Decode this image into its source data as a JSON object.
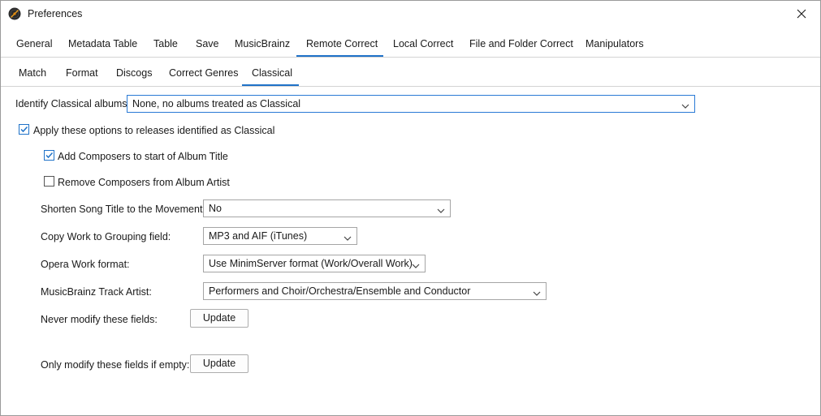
{
  "window": {
    "title": "Preferences",
    "app_icon": "record-disc-icon",
    "close_icon": "close-icon"
  },
  "main_tabs": [
    {
      "label": "General"
    },
    {
      "label": "Metadata Table"
    },
    {
      "label": "Table"
    },
    {
      "label": "Save"
    },
    {
      "label": "MusicBrainz"
    },
    {
      "label": "Remote Correct",
      "active": true
    },
    {
      "label": "Local Correct"
    },
    {
      "label": "File and Folder Correct"
    },
    {
      "label": "Manipulators"
    }
  ],
  "sub_tabs": [
    {
      "label": "Match"
    },
    {
      "label": "Format"
    },
    {
      "label": "Discogs"
    },
    {
      "label": "Correct Genres"
    },
    {
      "label": "Classical",
      "active": true
    }
  ],
  "form": {
    "identify_label": "Identify Classical albums :",
    "identify_value": "None, no albums treated as Classical",
    "apply_options": {
      "label": "Apply these options to releases identified as Classical",
      "checked": true
    },
    "add_composers": {
      "label": "Add Composers to start of Album Title",
      "checked": true
    },
    "remove_composers": {
      "label": "Remove Composers from Album Artist",
      "checked": false
    },
    "shorten_label": "Shorten Song Title to the Movement:",
    "shorten_value": "No",
    "copy_work_label": "Copy Work to Grouping field:",
    "copy_work_value": "MP3 and AIF (iTunes)",
    "opera_label": "Opera Work format:",
    "opera_value": "Use MinimServer format (Work/Overall Work)",
    "track_artist_label": "MusicBrainz Track Artist:",
    "track_artist_value": "Performers and Choir/Orchestra/Ensemble and Conductor",
    "never_modify_label": "Never modify these fields:",
    "never_modify_button": "Update",
    "only_modify_label": "Only modify these fields if empty:",
    "only_modify_button": "Update"
  },
  "colors": {
    "accent": "#1f72c8",
    "border": "#a5a5a5",
    "focus_border": "#2a7ad5"
  }
}
